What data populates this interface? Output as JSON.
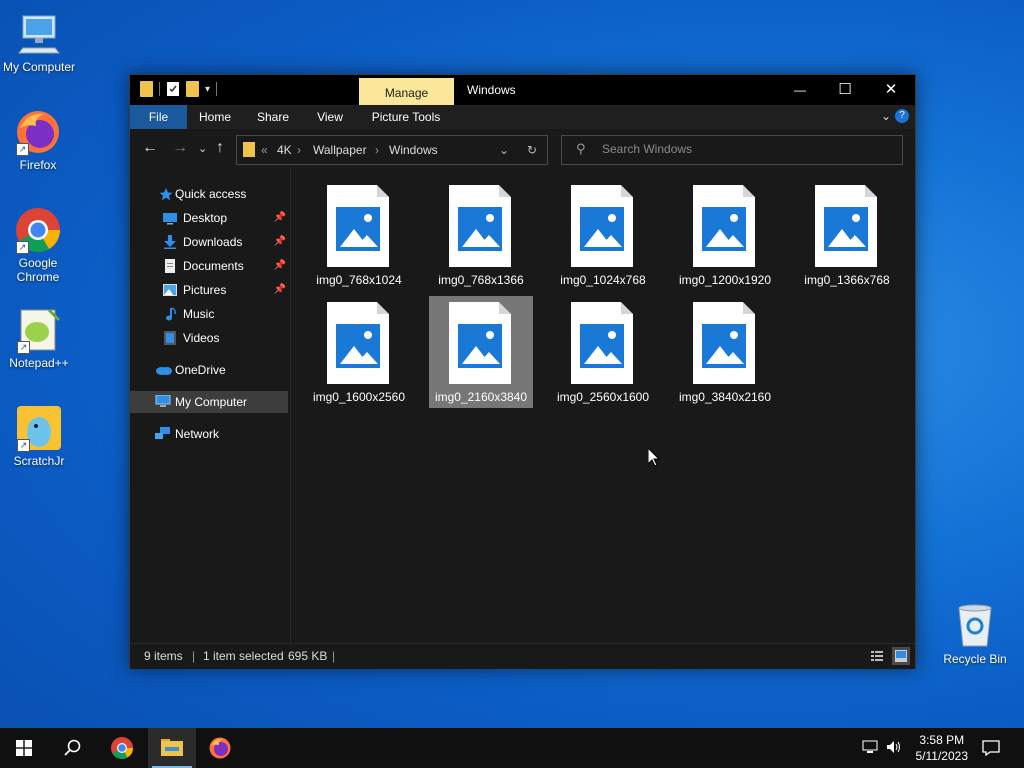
{
  "desktop": {
    "icons": [
      {
        "label": "My Computer"
      },
      {
        "label": "Firefox"
      },
      {
        "label": "Google Chrome"
      },
      {
        "label": "Notepad++"
      },
      {
        "label": "ScratchJr"
      },
      {
        "label": "Recycle Bin"
      }
    ]
  },
  "window": {
    "title": "Windows",
    "manage_tab": "Manage",
    "ribbon_tabs": [
      "File",
      "Home",
      "Share",
      "View",
      "Picture Tools"
    ],
    "controls": {
      "minimize": "—",
      "maximize": "☐",
      "close": "✕"
    }
  },
  "address": {
    "overflow": "«",
    "crumbs": [
      "4K",
      "Wallpaper",
      "Windows"
    ],
    "sep": "›"
  },
  "search": {
    "placeholder": "Search Windows"
  },
  "nav": {
    "quick_access": "Quick access",
    "items": [
      "Desktop",
      "Downloads",
      "Documents",
      "Pictures",
      "Music",
      "Videos"
    ],
    "onedrive": "OneDrive",
    "my_computer": "My Computer",
    "network": "Network"
  },
  "files": [
    "img0_768x1024",
    "img0_768x1366",
    "img0_1024x768",
    "img0_1200x1920",
    "img0_1366x768",
    "img0_1600x2560",
    "img0_2160x3840",
    "img0_2560x1600",
    "img0_3840x2160"
  ],
  "selected_file": "img0_2160x3840",
  "status": {
    "items": "9 items",
    "selected": "1 item selected",
    "size": "695 KB"
  },
  "taskbar": {
    "time": "3:58 PM",
    "date": "5/11/2023"
  },
  "colors": {
    "accent": "#1a73d8",
    "folder": "#f0c44c",
    "manage_tab": "#fbe79a"
  }
}
